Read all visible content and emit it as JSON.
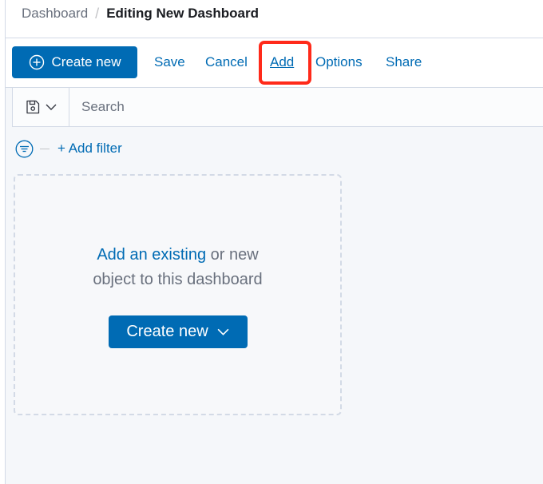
{
  "breadcrumbs": {
    "root": "Dashboard",
    "separator": "/",
    "current": "Editing New Dashboard"
  },
  "toolbar": {
    "create_new": "Create new",
    "save": "Save",
    "cancel": "Cancel",
    "add": "Add",
    "options": "Options",
    "share": "Share"
  },
  "search": {
    "placeholder": "Search",
    "value": ""
  },
  "filters": {
    "add_filter": "+ Add filter"
  },
  "empty_state": {
    "link_text": "Add an existing",
    "text_after_link": " or new",
    "line2": "object to this dashboard",
    "create_new": "Create new"
  },
  "colors": {
    "primary": "#006bb4",
    "highlight": "#ff2a1a"
  }
}
